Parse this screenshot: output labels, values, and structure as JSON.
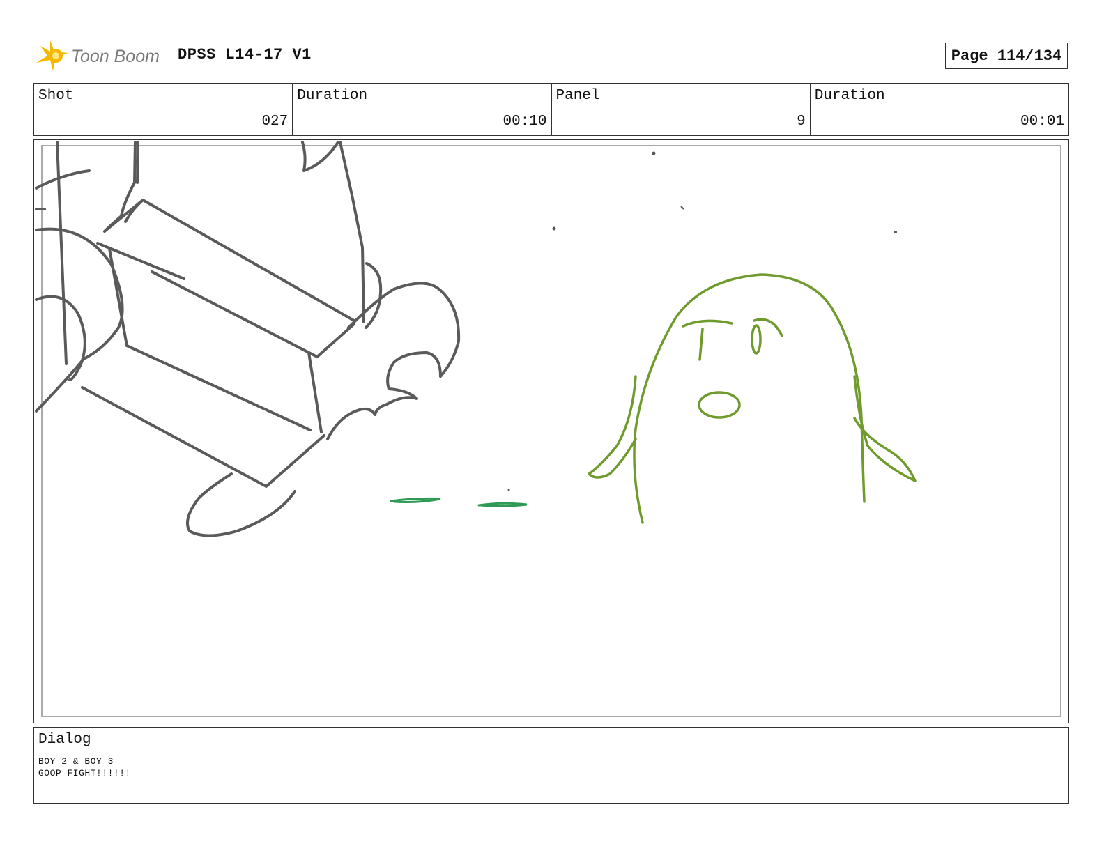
{
  "header": {
    "brand": "Toon Boom",
    "project_title": "DPSS L14-17 V1",
    "page_label": "Page 114/134"
  },
  "info": {
    "shot_label": "Shot",
    "shot_value": "027",
    "shot_duration_label": "Duration",
    "shot_duration_value": "00:10",
    "panel_label": "Panel",
    "panel_value": "9",
    "panel_duration_label": "Duration",
    "panel_duration_value": "00:01"
  },
  "dialog": {
    "label": "Dialog",
    "lines": [
      "BOY 2 & BOY 3",
      "GOOP FIGHT!!!!!!"
    ]
  },
  "colors": {
    "sketch_gray": "#5a5a5a",
    "goop_green": "#6f9a2c",
    "splat_green": "#2e9a55",
    "logo_yellow": "#f5b800",
    "logo_text": "#7a7a7a"
  }
}
